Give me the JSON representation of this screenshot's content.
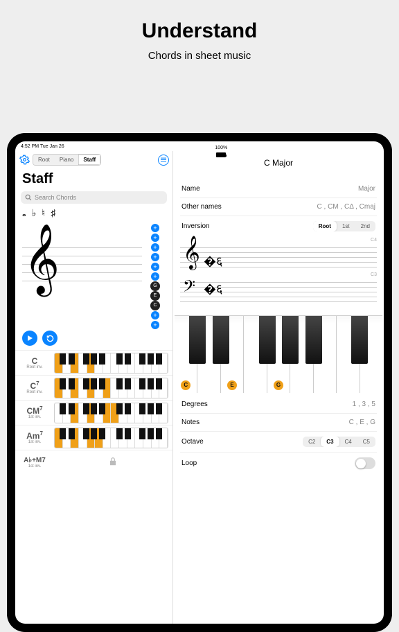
{
  "hero": {
    "title": "Understand",
    "subtitle": "Chords in sheet music"
  },
  "statusbar": {
    "time": "4:52 PM   Tue Jan 26",
    "wifi": "wifi",
    "batt_pct": "100%"
  },
  "left": {
    "tabs": [
      "Root",
      "Piano",
      "Staff"
    ],
    "title": "Staff",
    "search_placeholder": "Search Chords",
    "accidentals": [
      "𝅝",
      "♭",
      "♮",
      "♯"
    ],
    "chord_notes": [
      "G",
      "E",
      "C"
    ],
    "chord_list": [
      {
        "name": "C",
        "sup": "",
        "sub": "Root inv.",
        "hl": [
          0,
          2,
          4
        ]
      },
      {
        "name": "C",
        "sup": "7",
        "sub": "Root inv.",
        "hl": [
          0,
          2,
          4,
          6
        ]
      },
      {
        "name": "CM",
        "sup": "7",
        "sub": "1st inv.",
        "hl": [
          2,
          4,
          6,
          7
        ]
      },
      {
        "name": "Am",
        "sup": "7",
        "sub": "1st inv.",
        "hl": [
          0,
          2,
          4,
          5
        ]
      },
      {
        "name": "A♭+M7",
        "sup": "",
        "sub": "1st inv.",
        "hl": []
      }
    ]
  },
  "right": {
    "title": "C Major",
    "name_label": "Name",
    "name_value": "Major",
    "other_label": "Other names",
    "other_value": "C , CM , CΔ , Cmaj",
    "inversion_label": "Inversion",
    "inversion_opts": [
      "Root",
      "1st",
      "2nd"
    ],
    "oct_top": "C4",
    "oct_bottom": "C3",
    "piano_highlight": {
      "0": "C",
      "2": "E",
      "4": "G"
    },
    "degrees_label": "Degrees",
    "degrees_value": "1 , 3 , 5",
    "notes_label": "Notes",
    "notes_value": "C , E , G",
    "octave_label": "Octave",
    "octave_opts": [
      "C2",
      "C3",
      "C4",
      "C5"
    ],
    "loop_label": "Loop"
  }
}
